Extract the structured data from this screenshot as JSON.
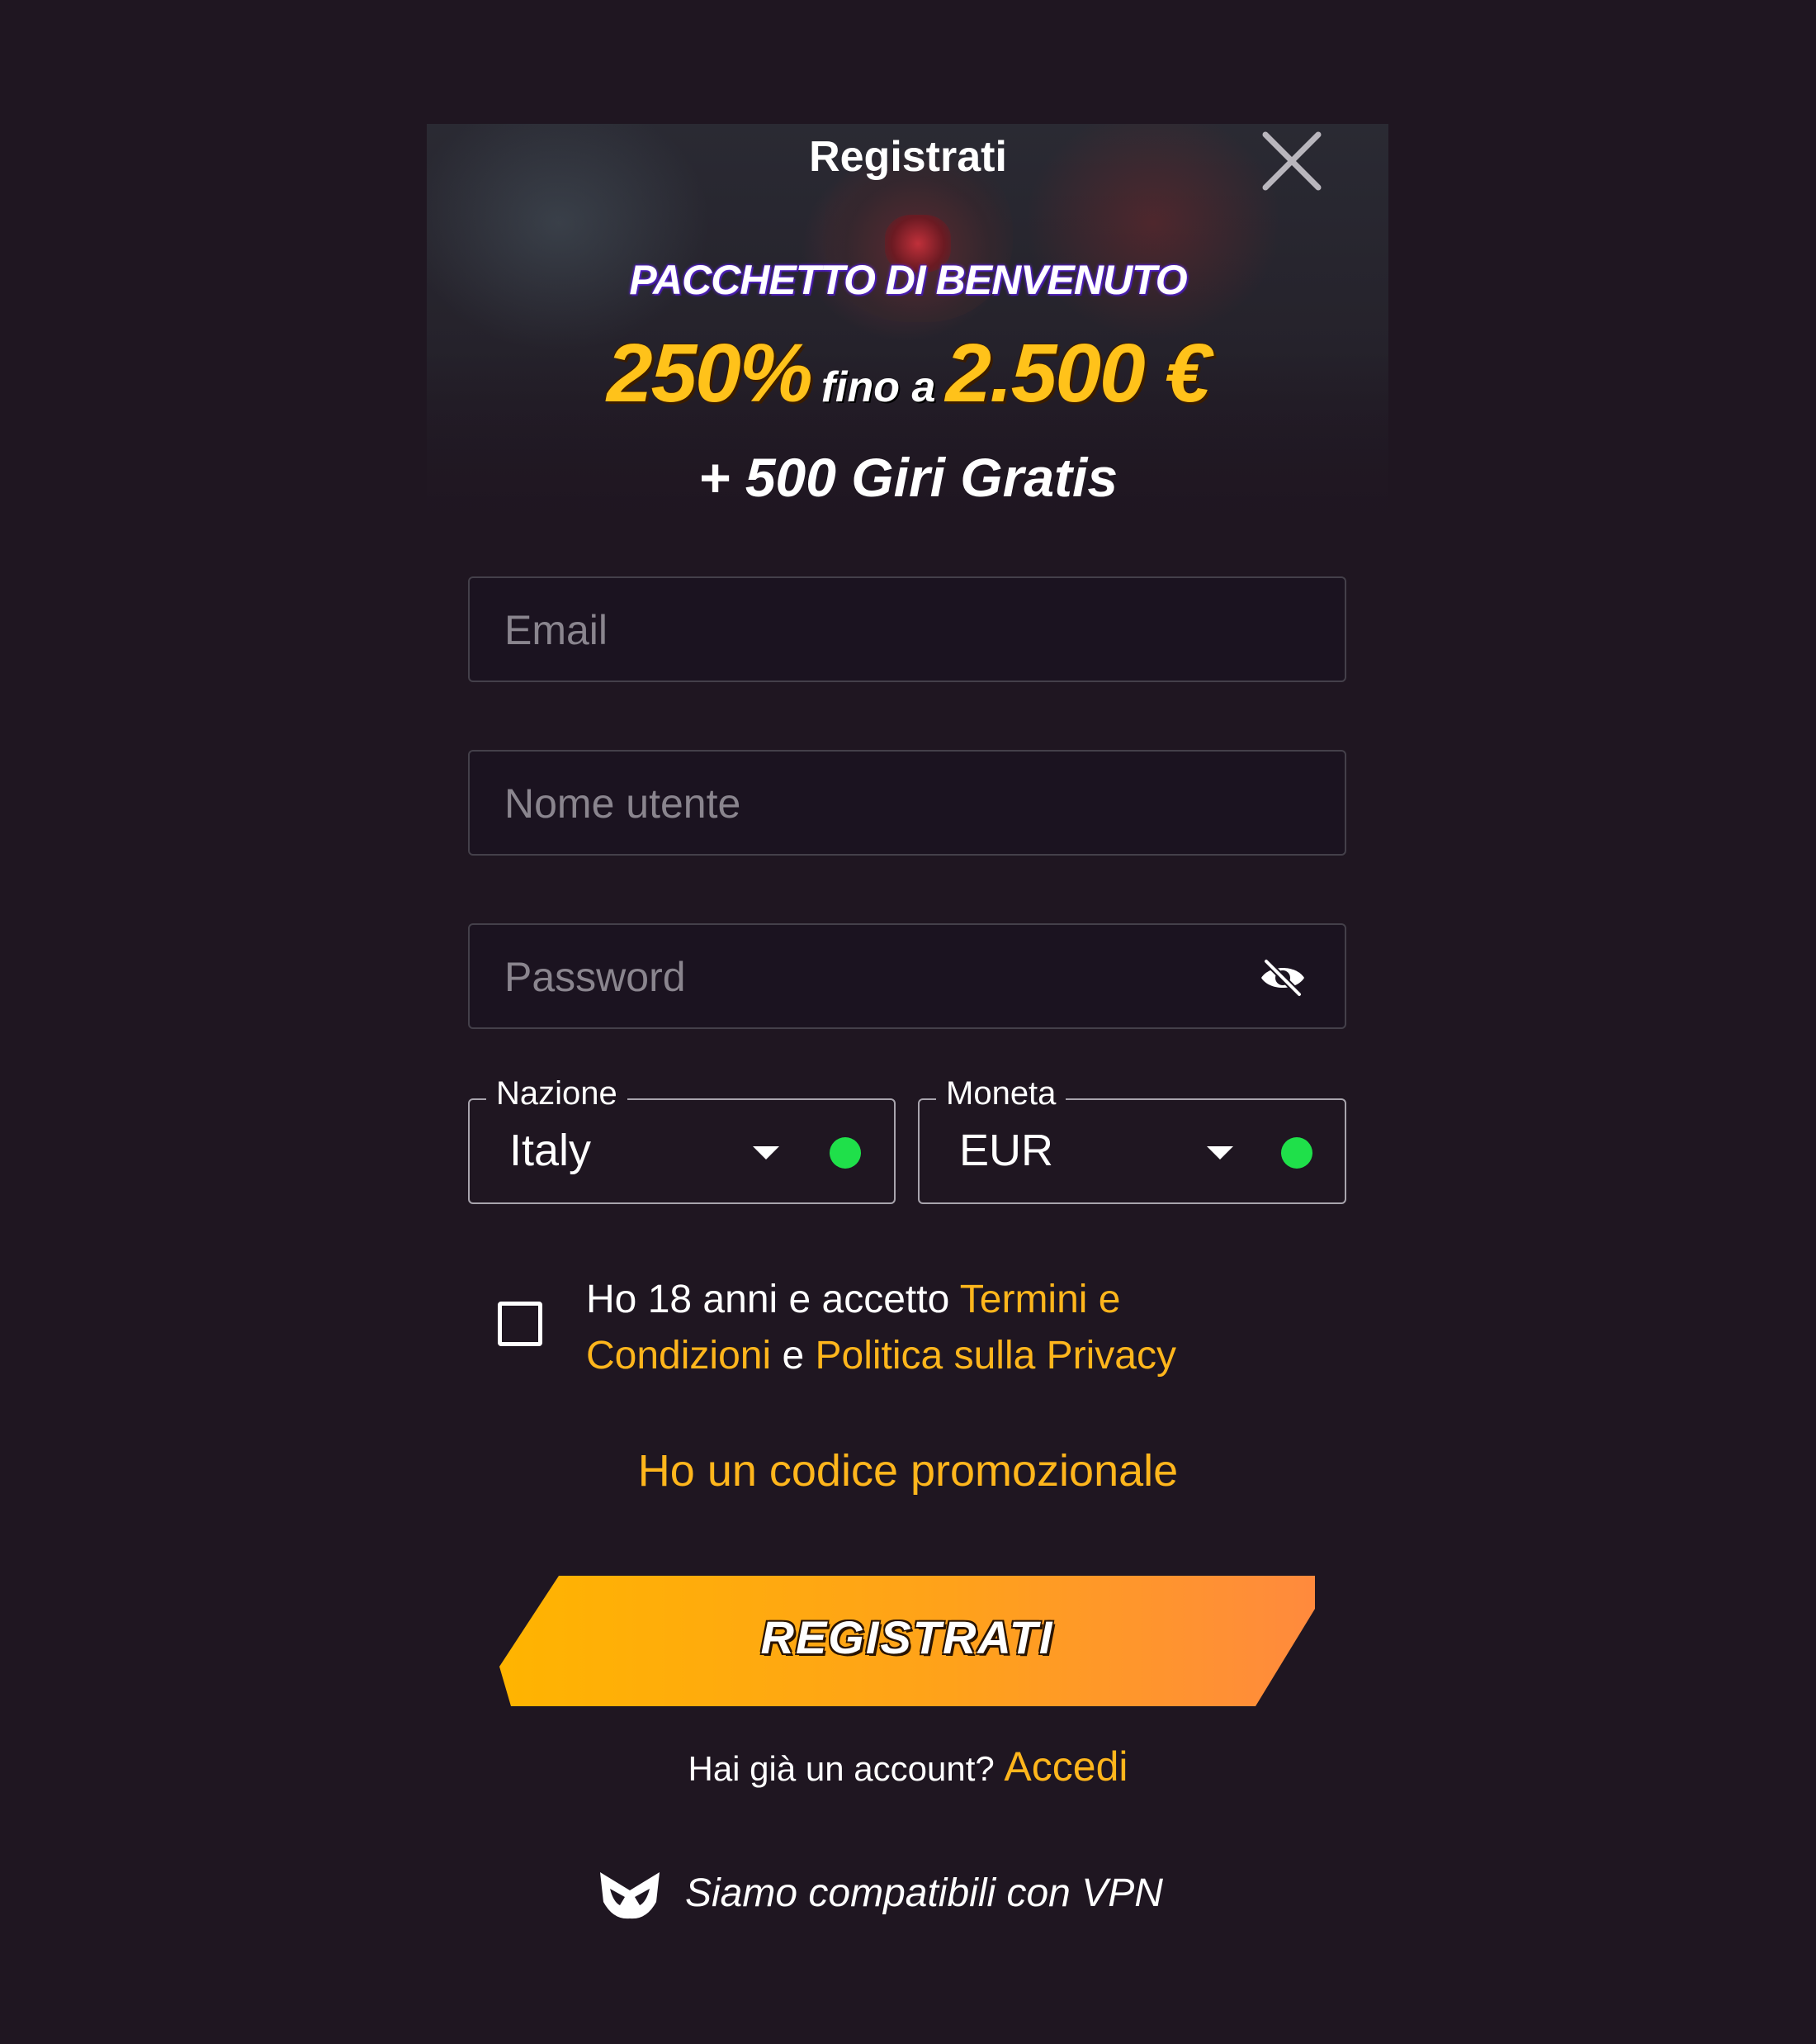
{
  "header": {
    "title": "Registrati",
    "close_icon": "close-icon"
  },
  "banner": {
    "promo_heading": "PACCHETTO DI BENVENUTO",
    "bonus_percent": "250%",
    "bonus_connector": "fino a",
    "bonus_amount": "2.500 €",
    "free_spins": "+ 500 Giri Gratis"
  },
  "form": {
    "email": {
      "placeholder": "Email",
      "value": ""
    },
    "username": {
      "placeholder": "Nome utente",
      "value": ""
    },
    "password": {
      "placeholder": "Password",
      "value": "",
      "toggle_icon": "eye-off-icon"
    },
    "country": {
      "label": "Nazione",
      "value": "Italy",
      "status_color": "#1fe04a"
    },
    "currency": {
      "label": "Moneta",
      "value": "EUR",
      "status_color": "#1fe04a"
    },
    "terms": {
      "checked": false,
      "text_before": "Ho 18 anni e accetto ",
      "terms_link": "Termini e Condizioni",
      "text_between": " e ",
      "privacy_link": "Politica sulla Privacy"
    },
    "promo_code_link": "Ho un codice promozionale",
    "submit_label": "REGISTRATI"
  },
  "footer": {
    "account_question": "Hai già un account?",
    "login_link": "Accedi",
    "vpn_text": "Siamo compatibili con VPN",
    "vpn_icon": "mask-icon"
  },
  "colors": {
    "background": "#1f1621",
    "accent": "#ffb61c",
    "button_gradient_start": "#ffb400",
    "button_gradient_end": "#ff8a3d"
  }
}
